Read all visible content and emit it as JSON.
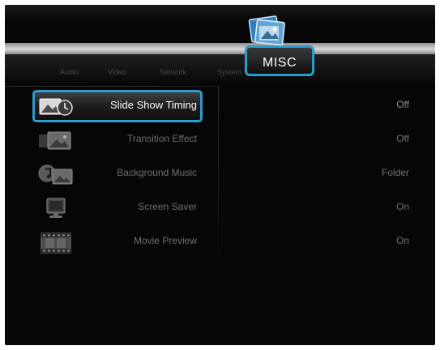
{
  "tabs": [
    {
      "label": "Audio"
    },
    {
      "label": "Video"
    },
    {
      "label": "Network"
    },
    {
      "label": "System"
    }
  ],
  "active_tab": {
    "label": "MISC",
    "icon": "photo-stack-icon"
  },
  "colors": {
    "accent": "#2a9ccd",
    "background": "#060606"
  },
  "settings": [
    {
      "label": "Slide Show Timing",
      "value": "Off",
      "icon": "slideshow-timer-icon"
    },
    {
      "label": "Transition Effect",
      "value": "Off",
      "icon": "transition-image-icon"
    },
    {
      "label": "Background Music",
      "value": "Folder",
      "icon": "music-image-icon"
    },
    {
      "label": "Screen Saver",
      "value": "On",
      "icon": "monitor-icon"
    },
    {
      "label": "Movie Preview",
      "value": "On",
      "icon": "film-strip-icon"
    }
  ]
}
